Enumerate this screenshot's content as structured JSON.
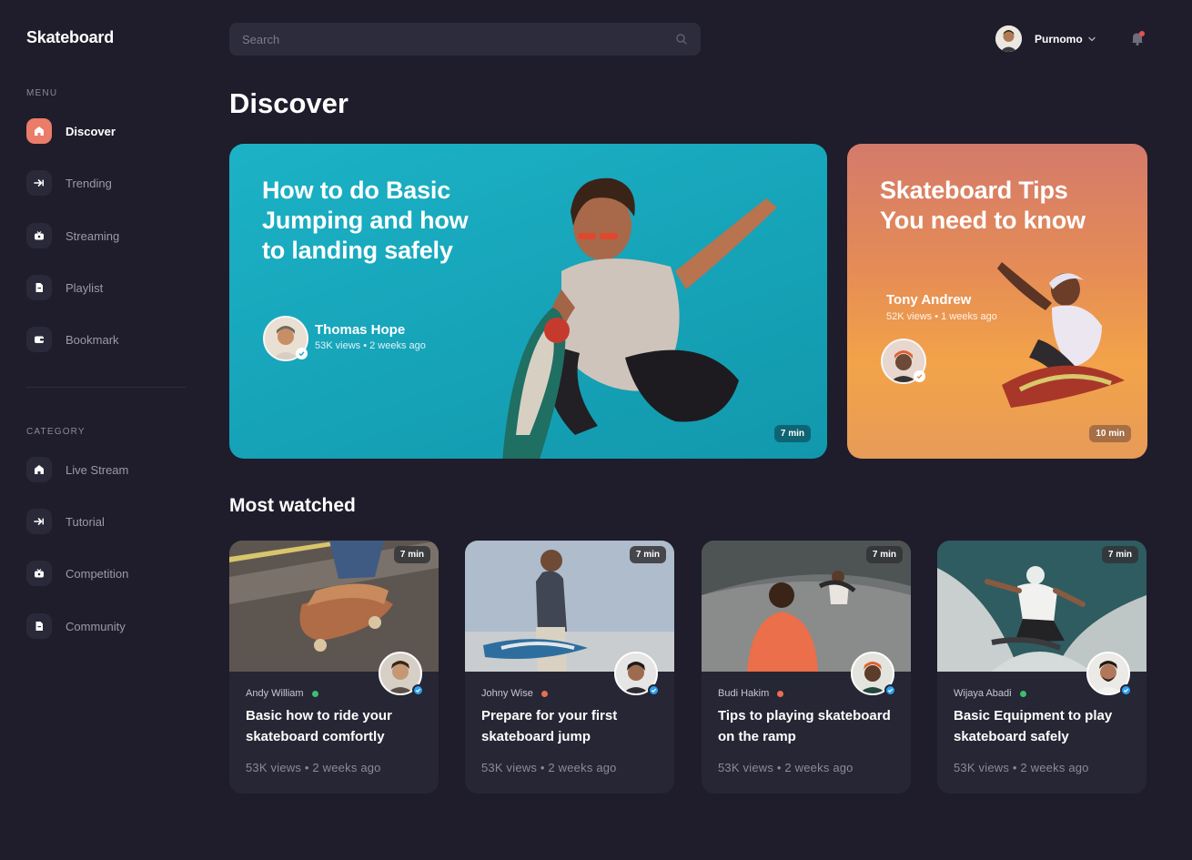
{
  "app": {
    "brand": "Skateboard"
  },
  "sidebar": {
    "menu_label": "MENU",
    "menu": [
      {
        "label": "Discover",
        "icon": "home-icon",
        "active": true
      },
      {
        "label": "Trending",
        "icon": "arrow-right-icon"
      },
      {
        "label": "Streaming",
        "icon": "stream-icon"
      },
      {
        "label": "Playlist",
        "icon": "document-icon"
      },
      {
        "label": "Bookmark",
        "icon": "wallet-icon"
      }
    ],
    "category_label": "CATEGORY",
    "categories": [
      {
        "label": "Live Stream",
        "icon": "home-icon"
      },
      {
        "label": "Tutorial",
        "icon": "arrow-right-icon"
      },
      {
        "label": "Competition",
        "icon": "stream-icon"
      },
      {
        "label": "Community",
        "icon": "document-icon"
      }
    ]
  },
  "header": {
    "search_placeholder": "Search",
    "user_name": "Purnomo",
    "has_notification": true
  },
  "page_title": "Discover",
  "featured": [
    {
      "title": "How to do Basic Jumping and how to landing safely",
      "author": "Thomas Hope",
      "meta": "53K views • 2 weeks ago",
      "duration": "7 min"
    },
    {
      "title": "Skateboard Tips You need to know",
      "author": "Tony Andrew",
      "meta": "52K views • 1 weeks ago",
      "duration": "10 min"
    }
  ],
  "most_watched_title": "Most watched",
  "videos": [
    {
      "author": "Andy William",
      "status_color": "#3bbf6e",
      "title": "Basic how to ride your skateboard comfortly",
      "meta": "53K views • 2 weeks ago",
      "duration": "7 min"
    },
    {
      "author": "Johny Wise",
      "status_color": "#ea6d53",
      "title": "Prepare for your first skateboard jump",
      "meta": "53K views • 2 weeks ago",
      "duration": "7 min"
    },
    {
      "author": "Budi Hakim",
      "status_color": "#ea6d53",
      "title": "Tips to playing skateboard on the ramp",
      "meta": "53K views • 2 weeks ago",
      "duration": "7 min"
    },
    {
      "author": "Wijaya Abadi",
      "status_color": "#3bbf6e",
      "title": "Basic Equipment to play skateboard safely",
      "meta": "53K views • 2 weeks ago",
      "duration": "7 min"
    }
  ],
  "colors": {
    "background": "#1f1d2b",
    "card": "#262635",
    "accent": "#ea7c69"
  }
}
